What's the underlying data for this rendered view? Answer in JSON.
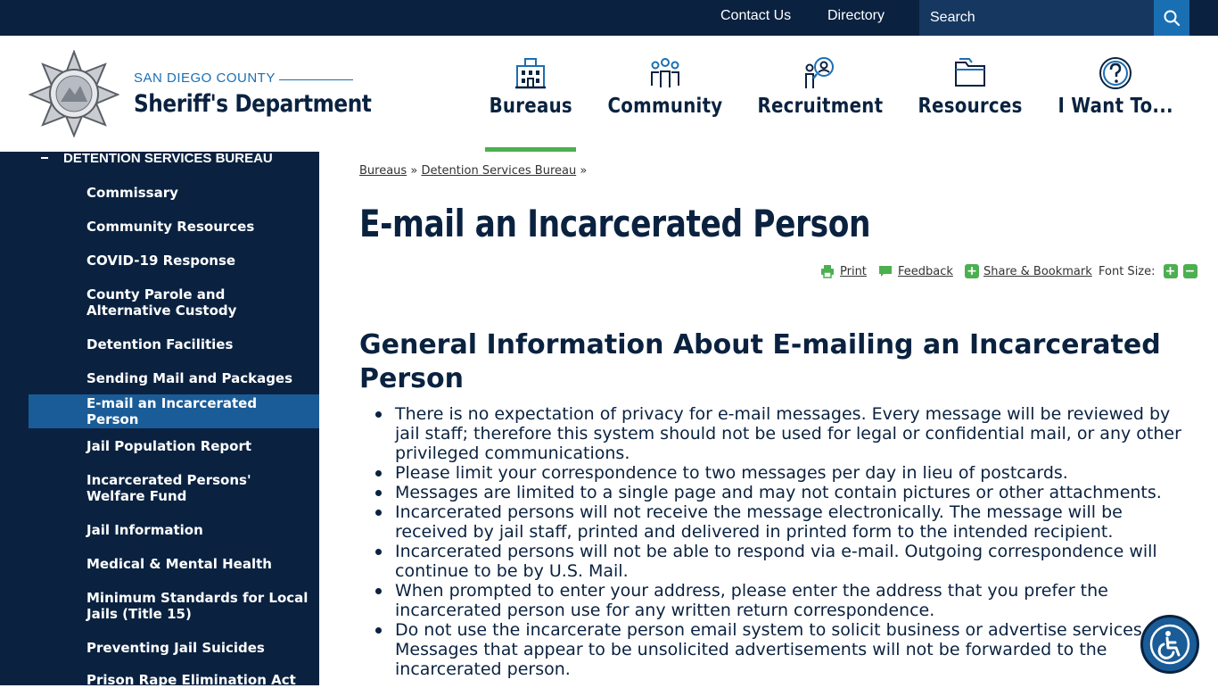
{
  "topbar": {
    "contact_label": "Contact Us",
    "directory_label": "Directory",
    "search_placeholder": "Search"
  },
  "header": {
    "logo_county": "SAN DIEGO COUNTY",
    "logo_department": "Sheriff's Department",
    "nav": [
      {
        "label": "Bureaus",
        "icon": "building-icon",
        "active": true
      },
      {
        "label": "Community",
        "icon": "people-icon"
      },
      {
        "label": "Recruitment",
        "icon": "recruit-search-icon"
      },
      {
        "label": "Resources",
        "icon": "folder-icon"
      },
      {
        "label": "I Want To...",
        "icon": "question-icon"
      }
    ]
  },
  "sidebar": {
    "parent": "DETENTION SERVICES BUREAU",
    "items": [
      {
        "label": "Commissary"
      },
      {
        "label": "Community Resources"
      },
      {
        "label": "COVID-19 Response"
      },
      {
        "label": "County Parole and Alternative Custody"
      },
      {
        "label": "Detention Facilities"
      },
      {
        "label": "Sending Mail and Packages"
      },
      {
        "label": "E-mail an Incarcerated Person",
        "active": true
      },
      {
        "label": "Jail Population Report"
      },
      {
        "label": "Incarcerated Persons' Welfare Fund"
      },
      {
        "label": "Jail Information"
      },
      {
        "label": "Medical & Mental Health"
      },
      {
        "label": "Minimum Standards for Local Jails (Title 15)"
      },
      {
        "label": "Preventing Jail Suicides"
      },
      {
        "label": "Prison Rape Elimination Act"
      }
    ]
  },
  "breadcrumb": {
    "items": [
      "Bureaus",
      "Detention Services Bureau"
    ],
    "separator": "»"
  },
  "page": {
    "title": "E-mail an Incarcerated Person",
    "tools": {
      "print": "Print",
      "feedback": "Feedback",
      "share": "Share & Bookmark",
      "font_size": "Font Size:"
    },
    "section_heading": "General Information About E-mailing an Incarcerated Person",
    "bullets": [
      "There is no expectation of privacy for e-mail messages. Every message will be reviewed by jail staff; therefore this system should not be used for legal or confidential mail, or any other privileged communications.",
      "Please limit your correspondence to two messages per day in lieu of postcards.",
      "Messages are limited to a single page and may not contain pictures or other attachments.",
      "Incarcerated persons will not receive the message electronically. The message will be received by jail staff, printed and delivered in printed form to the intended recipient.",
      "Incarcerated persons will not be able to respond via e-mail. Outgoing correspondence will continue to be by U.S. Mail.",
      "When prompted to enter your address, please enter the address that you prefer the incarcerated person use for any written return correspondence.",
      "Do not use the incarcerate person email system to solicit business or advertise services. Messages that appear to be unsolicited advertisements will not be forwarded to the incarcerated person."
    ]
  },
  "colors": {
    "navy": "#0a2240",
    "blue": "#1a6fb3",
    "active_blue": "#1a5c97",
    "green": "#4caf50"
  }
}
